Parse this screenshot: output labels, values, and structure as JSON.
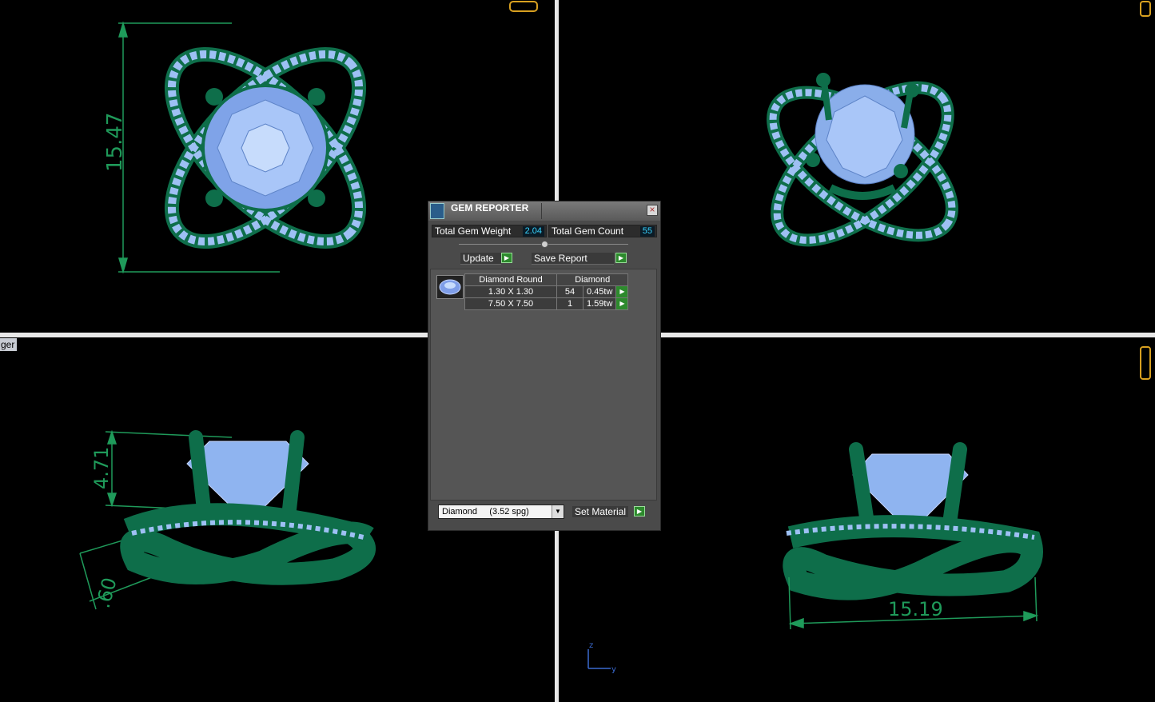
{
  "viewports": {
    "label": "ger",
    "top_left_dimension": "15.47",
    "bottom_left_dimension_height": "4.71",
    "bottom_left_dimension_small": ".60",
    "bottom_right_dimension": "15.19",
    "axis_z": "z",
    "axis_y": "y"
  },
  "gem_reporter": {
    "title": "GEM REPORTER",
    "close": "×",
    "total_weight_label": "Total Gem Weight",
    "total_weight_value": "2.04",
    "total_count_label": "Total Gem Count",
    "total_count_value": "55",
    "update_label": "Update",
    "save_report_label": "Save Report",
    "table_headers": [
      "Diamond Round",
      "Diamond"
    ],
    "rows": [
      {
        "size": "1.30 X 1.30",
        "count": "54",
        "weight": "0.45tw"
      },
      {
        "size": "7.50 X 7.50",
        "count": "1",
        "weight": "1.59tw"
      }
    ],
    "material_select": "Diamond     (3.52 spg)",
    "set_material_label": "Set Material",
    "go_glyph": "▶",
    "select_arrow": "▼"
  },
  "colors": {
    "metal": "#0e6e4a",
    "gem": "#8fb4f0",
    "dimension": "#1f9a5a"
  }
}
